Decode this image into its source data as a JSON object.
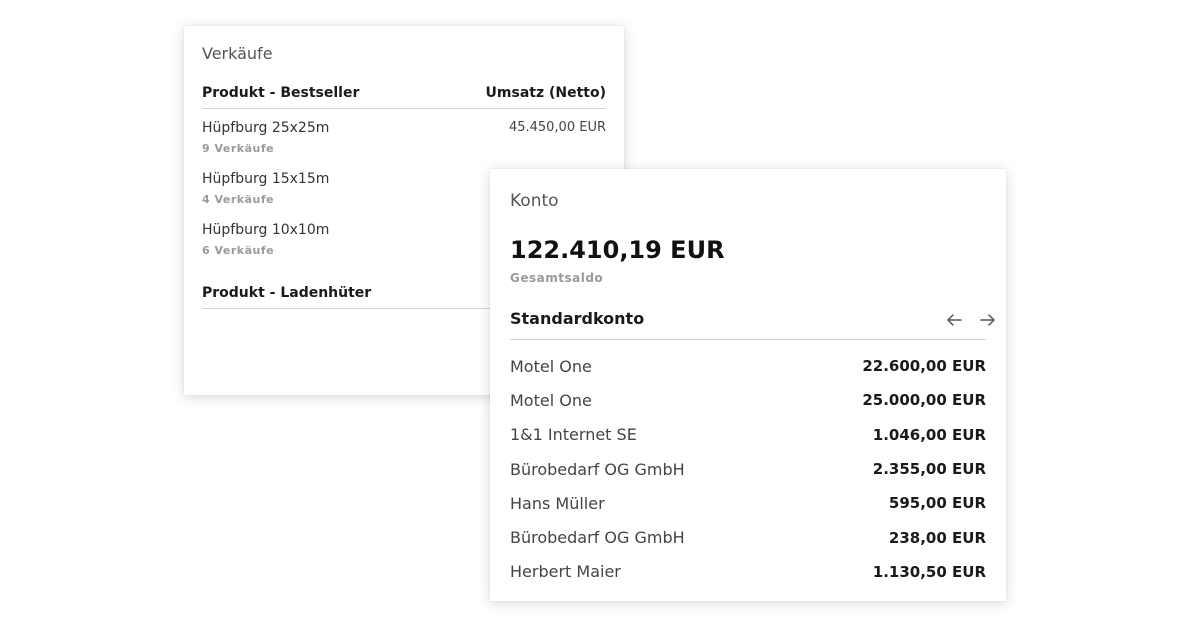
{
  "sales": {
    "title": "Verkäufe",
    "bestseller_header": "Produkt - Bestseller",
    "revenue_header": "Umsatz (Netto)",
    "items": [
      {
        "name": "Hüpfburg 25x25m",
        "count": "9 Verkäufe",
        "revenue": "45.450,00 EUR"
      },
      {
        "name": "Hüpfburg 15x15m",
        "count": "4 Verkäufe",
        "revenue": ""
      },
      {
        "name": "Hüpfburg 10x10m",
        "count": "6 Verkäufe",
        "revenue": ""
      }
    ],
    "slowseller_header": "Produkt - Ladenhüter"
  },
  "konto": {
    "title": "Konto",
    "balance": "122.410,19 EUR",
    "balance_label": "Gesamtsaldo",
    "account_name": "Standardkonto",
    "nav": {
      "prev_icon": "arrow-left-icon",
      "next_icon": "arrow-right-icon"
    },
    "transactions": [
      {
        "name": "Motel One",
        "amount": "22.600,00 EUR"
      },
      {
        "name": "Motel One",
        "amount": "25.000,00 EUR"
      },
      {
        "name": "1&1 Internet SE",
        "amount": "1.046,00 EUR"
      },
      {
        "name": "Bürobedarf OG GmbH",
        "amount": "2.355,00 EUR"
      },
      {
        "name": "Hans Müller",
        "amount": "595,00 EUR"
      },
      {
        "name": "Bürobedarf OG GmbH",
        "amount": "238,00 EUR"
      },
      {
        "name": "Herbert Maier",
        "amount": "1.130,50 EUR"
      }
    ]
  },
  "colors": {
    "background": "#ffffff",
    "text_primary": "#1a1a1a",
    "text_muted": "#9a9a9a",
    "divider": "#cfcfcf"
  }
}
